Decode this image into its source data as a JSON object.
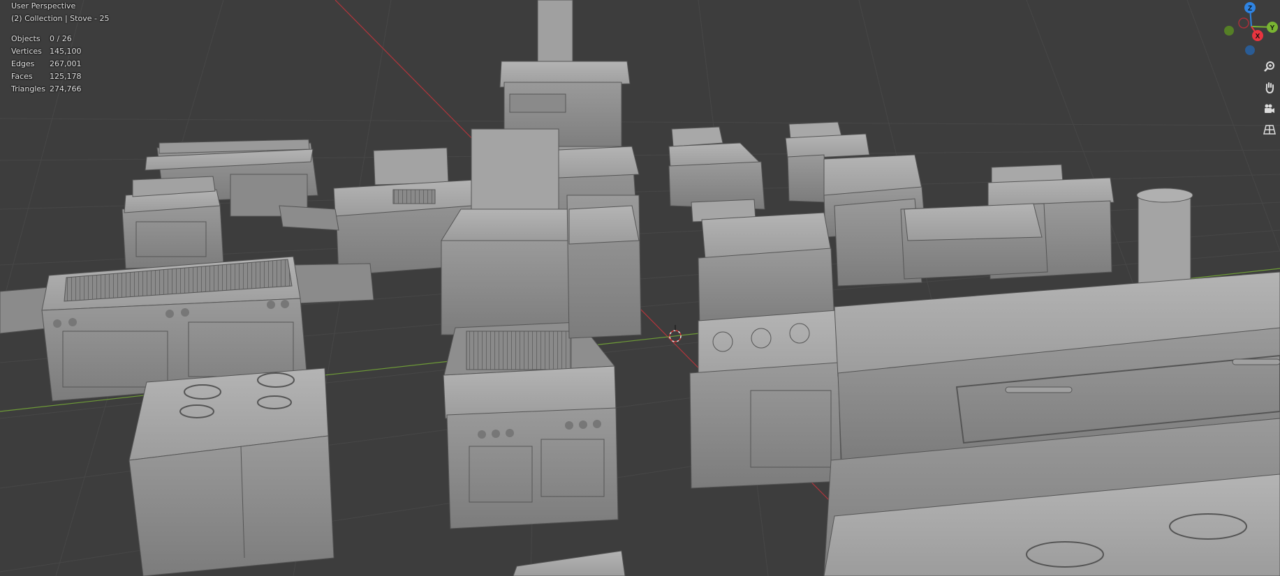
{
  "viewport": {
    "perspective_label": "User Perspective",
    "collection_label": "(2) Collection | Stove - 25"
  },
  "stats": [
    {
      "key": "Objects",
      "value": "0 / 26"
    },
    {
      "key": "Vertices",
      "value": "145,100"
    },
    {
      "key": "Edges",
      "value": "267,001"
    },
    {
      "key": "Faces",
      "value": "125,178"
    },
    {
      "key": "Triangles",
      "value": "274,766"
    }
  ],
  "gizmo": {
    "axes": [
      {
        "label": "Z",
        "color": "#2f84e3"
      },
      {
        "label": "X",
        "color": "#e8343f"
      },
      {
        "label": "Y",
        "color": "#79b532"
      }
    ]
  },
  "nav_tools": [
    {
      "name": "zoom-icon"
    },
    {
      "name": "pan-hand-icon"
    },
    {
      "name": "camera-icon"
    },
    {
      "name": "grid-perspective-icon"
    }
  ],
  "colors": {
    "background": "#3d3d3d",
    "grid": "#474747",
    "axis_x": "#b3353c",
    "axis_y": "#6f9d37",
    "model_light": "#a8a8a8",
    "model_mid": "#8c8c8c",
    "model_dark": "#6a6a6a"
  }
}
